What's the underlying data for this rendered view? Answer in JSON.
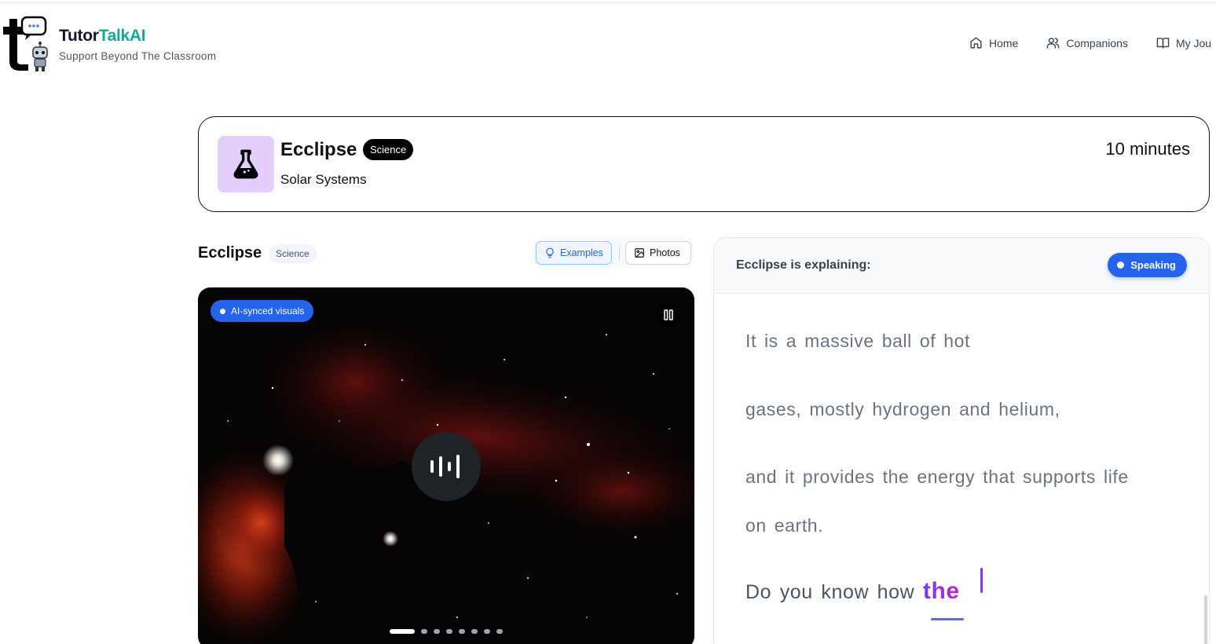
{
  "brand": {
    "name_part1": "Tutor",
    "name_part2": "TalkAI",
    "tagline": "Support Beyond The Classroom",
    "teal": "#14a89c"
  },
  "nav": {
    "items": [
      {
        "label": "Home",
        "icon": "home-icon"
      },
      {
        "label": "Companions",
        "icon": "users-icon"
      },
      {
        "label": "My Jou",
        "icon": "book-icon"
      }
    ]
  },
  "companion": {
    "name": "Ecclipse",
    "subject": "Science",
    "topic": "Solar Systems",
    "duration": "10 minutes",
    "icon": "flask-icon",
    "icon_bg": "#e4cffc"
  },
  "visual_panel": {
    "title": "Ecclipse",
    "subject": "Science",
    "examples_label": "Examples",
    "photos_label": "Photos",
    "ai_badge": "AI-synced visuals",
    "slide_count": 8,
    "active_slide": 0,
    "accent": "#2563eb"
  },
  "transcript": {
    "header": "Ecclipse is explaining:",
    "status": "Speaking",
    "lines": [
      "It is a massive ball of hot",
      "gases, mostly hydrogen and helium,",
      "and it provides the energy that supports life",
      "on earth."
    ],
    "current_prefix": "Do you know how",
    "current_word": "the"
  }
}
